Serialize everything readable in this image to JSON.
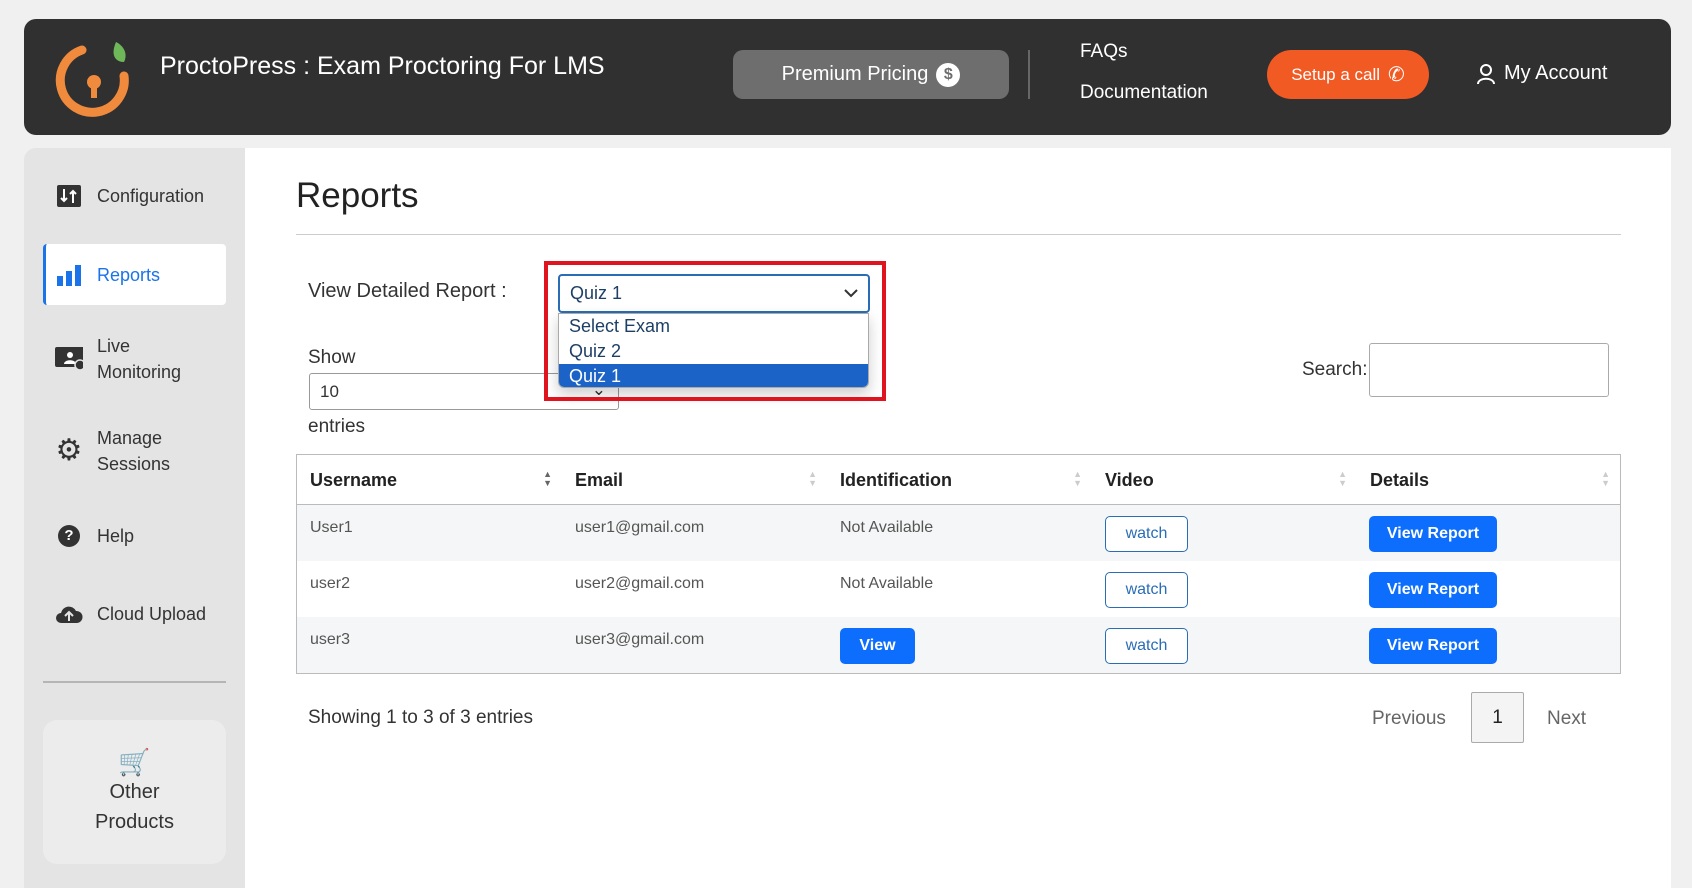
{
  "header": {
    "title": "ProctoPress : Exam Proctoring For LMS",
    "premium_label": "Premium Pricing",
    "faqs": "FAQs",
    "documentation": "Documentation",
    "setup_label": "Setup a call",
    "account_label": "My Account",
    "accent": "#f25a24"
  },
  "sidebar": {
    "items": [
      {
        "label": "Configuration",
        "icon": "sliders-icon"
      },
      {
        "label": "Reports",
        "icon": "bar-chart-icon",
        "active": true
      },
      {
        "label": "Live Monitoring",
        "icon": "monitor-user-icon"
      },
      {
        "label": "Manage Sessions",
        "icon": "gear-icon"
      },
      {
        "label": "Help",
        "icon": "question-circle-icon"
      },
      {
        "label": "Cloud Upload",
        "icon": "cloud-upload-icon"
      }
    ],
    "other_products": "Other Products"
  },
  "main": {
    "title": "Reports",
    "view_label": "View Detailed Report :",
    "selected_exam": "Quiz 1",
    "exam_options": [
      "Select Exam",
      "Quiz 2",
      "Quiz 1"
    ],
    "show_label": "Show",
    "length_value": "10",
    "entries_label": "entries",
    "search_label": "Search:",
    "search_value": "",
    "columns": [
      "Username",
      "Email",
      "Identification",
      "Video",
      "Details"
    ],
    "rows": [
      {
        "username": "User1",
        "email": "user1@gmail.com",
        "identification": "Not Available",
        "video": "watch",
        "details": "View Report"
      },
      {
        "username": "user2",
        "email": "user2@gmail.com",
        "identification": "Not Available",
        "video": "watch",
        "details": "View Report"
      },
      {
        "username": "user3",
        "email": "user3@gmail.com",
        "identification": "View",
        "video": "watch",
        "details": "View Report"
      }
    ],
    "info": "Showing 1 to 3 of 3 entries",
    "previous": "Previous",
    "page": "1",
    "next": "Next"
  }
}
